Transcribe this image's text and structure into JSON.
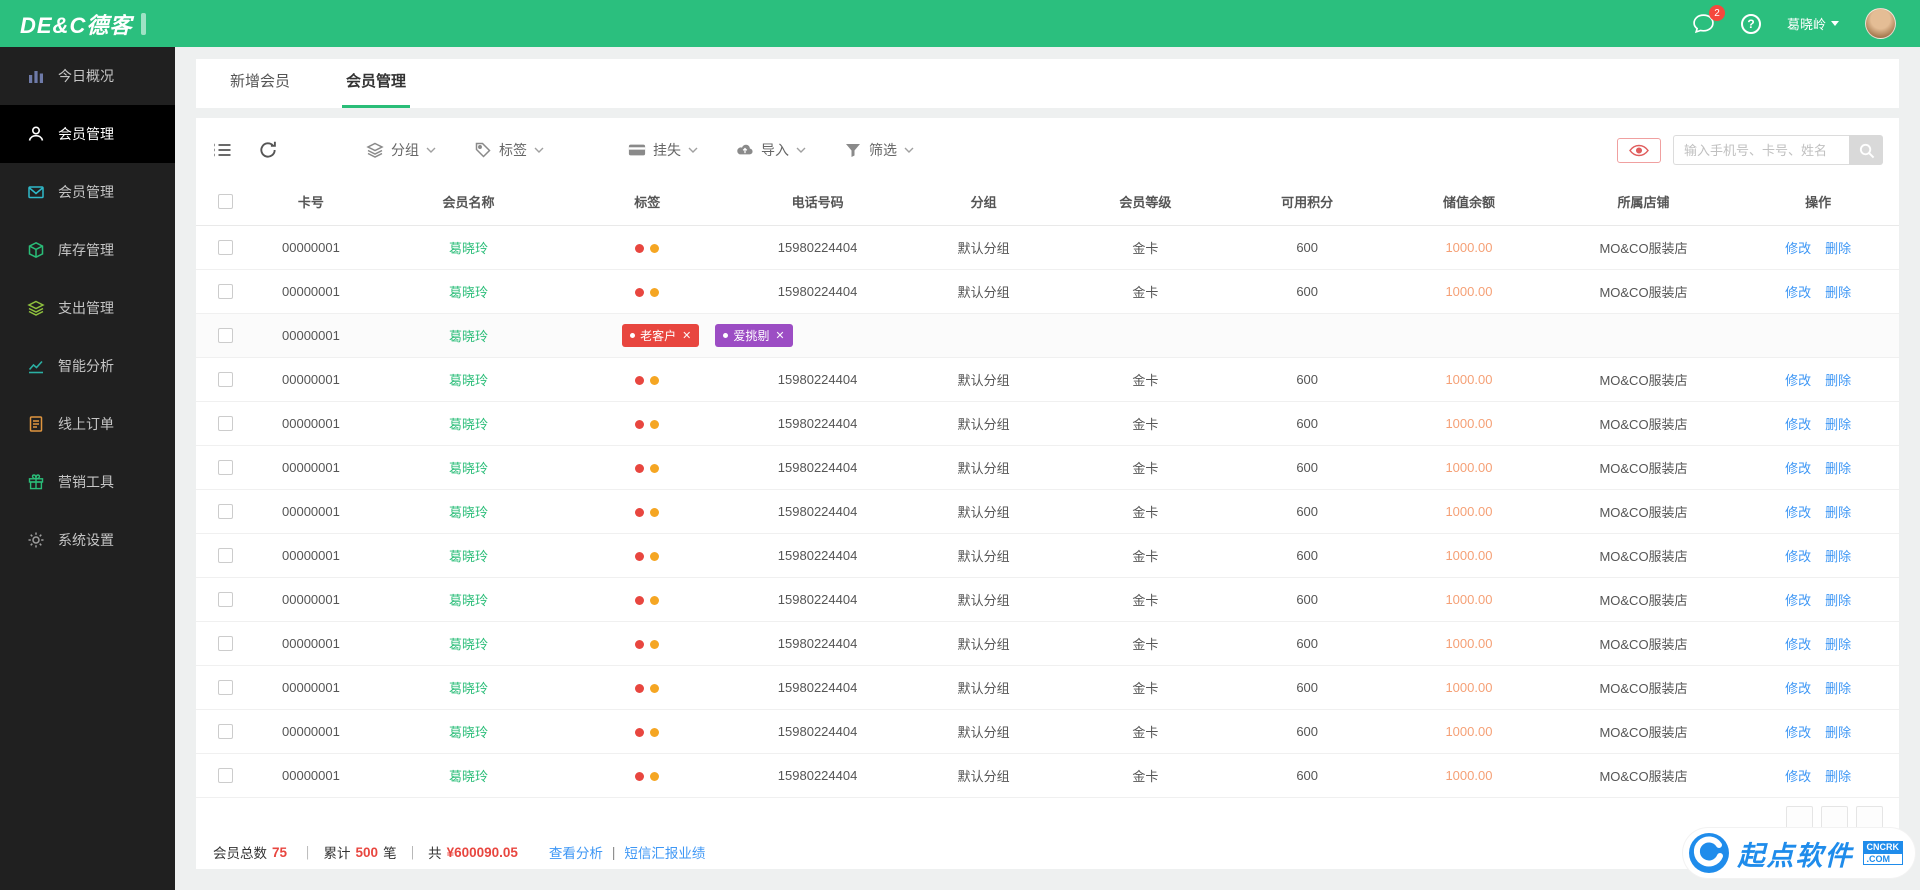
{
  "colors": {
    "accent": "#2abd78",
    "topbar": "#2bbf7e",
    "link": "#3e97f5",
    "danger": "#e8463f",
    "money": "#f5a076"
  },
  "topbar": {
    "logo": "DE&C德客",
    "message_badge": "2",
    "help": "?",
    "username": "葛晓岭"
  },
  "sidebar": {
    "items": [
      {
        "label": "今日概况",
        "icon": "bar-chart-icon",
        "color": "#6e7aa8",
        "active": false
      },
      {
        "label": "会员管理",
        "icon": "user-icon",
        "color": "#ffffff",
        "active": true
      },
      {
        "label": "会员管理",
        "icon": "mail-icon",
        "color": "#2fb9c9",
        "active": false
      },
      {
        "label": "库存管理",
        "icon": "box-icon",
        "color": "#2abd78",
        "active": false
      },
      {
        "label": "支出管理",
        "icon": "layers-icon",
        "color": "#8fc13e",
        "active": false
      },
      {
        "label": "智能分析",
        "icon": "trend-icon",
        "color": "#2bb0a3",
        "active": false
      },
      {
        "label": "线上订单",
        "icon": "doc-icon",
        "color": "#e0953f",
        "active": false
      },
      {
        "label": "营销工具",
        "icon": "gift-icon",
        "color": "#2abd78",
        "active": false
      },
      {
        "label": "系统设置",
        "icon": "gear-icon",
        "color": "#9e9e9e",
        "active": false
      }
    ]
  },
  "tabs": [
    {
      "label": "新增会员",
      "active": false
    },
    {
      "label": "会员管理",
      "active": true
    }
  ],
  "toolbar": {
    "buttons": [
      {
        "label": "分组",
        "icon": "group-icon"
      },
      {
        "label": "标签",
        "icon": "tag-icon"
      },
      {
        "label": "挂失",
        "icon": "card-icon"
      },
      {
        "label": "导入",
        "icon": "import-icon"
      },
      {
        "label": "筛选",
        "icon": "filter-icon"
      }
    ],
    "search_placeholder": "输入手机号、卡号、姓名"
  },
  "table": {
    "headers": [
      "卡号",
      "会员名称",
      "标签",
      "电话号码",
      "分组",
      "会员等级",
      "可用积分",
      "储值余额",
      "所属店铺",
      "操作"
    ],
    "actions": {
      "edit": "修改",
      "delete": "删除"
    },
    "row_count": 13,
    "special_row_index": 2,
    "default_row": {
      "card": "00000001",
      "name": "葛晓玲",
      "tag_dots": [
        {
          "color": "#e8463f"
        },
        {
          "color": "#f5a623"
        }
      ],
      "phone": "15980224404",
      "group": "默认分组",
      "level": "金卡",
      "points": "600",
      "balance": "1000.00",
      "store": "MO&CO服装店"
    },
    "special_row": {
      "card": "00000001",
      "name": "葛晓玲",
      "chips": [
        {
          "label": "老客户",
          "color": "#e8463f"
        },
        {
          "label": "爱挑剔",
          "color": "#9c4dc4"
        }
      ]
    }
  },
  "pagination": {
    "box_count": 3
  },
  "footer": {
    "total_label": "会员总数",
    "total_value": "75",
    "sep": "｜",
    "cumulative_label": "累计",
    "cumulative_value": "500",
    "cumulative_unit": "笔",
    "sum_label": "共",
    "sum_value": "¥600090.05",
    "link_analysis": "查看分析",
    "divider": "|",
    "link_sms": "短信汇报业绩"
  },
  "watermark": {
    "brand": "起点软件",
    "tld_top": "CNCRK",
    "tld_bottom": ".COM"
  }
}
